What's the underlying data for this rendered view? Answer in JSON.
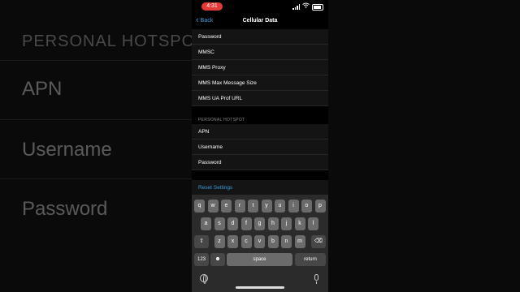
{
  "background": {
    "section_header": "PERSONAL HOTSPOT",
    "items": [
      "APN",
      "Username",
      "Password"
    ]
  },
  "status": {
    "time": "4:31"
  },
  "nav": {
    "back_label": "Back",
    "title": "Cellular Data"
  },
  "mms_rows": [
    "Password",
    "MMSC",
    "MMS Proxy",
    "MMS Max Message Size",
    "MMS UA Prof URL"
  ],
  "hotspot": {
    "header": "PERSONAL HOTSPOT",
    "rows": [
      "APN",
      "Username",
      "Password"
    ]
  },
  "reset_label": "Reset Settings",
  "keyboard": {
    "row1": [
      "q",
      "w",
      "e",
      "r",
      "t",
      "y",
      "u",
      "i",
      "o",
      "p"
    ],
    "row2": [
      "a",
      "s",
      "d",
      "f",
      "g",
      "h",
      "j",
      "k",
      "l"
    ],
    "row3": [
      "z",
      "x",
      "c",
      "v",
      "b",
      "n",
      "m"
    ],
    "numbers_key": "123",
    "space_key": "space",
    "return_key": "return"
  },
  "colors": {
    "accent": "#3a9bdc",
    "recording": "#e53935"
  },
  "icons": [
    "shift-icon",
    "delete-icon",
    "emoji-icon",
    "globe-icon",
    "microphone-icon",
    "wifi-icon",
    "battery-icon",
    "signal-icon"
  ]
}
